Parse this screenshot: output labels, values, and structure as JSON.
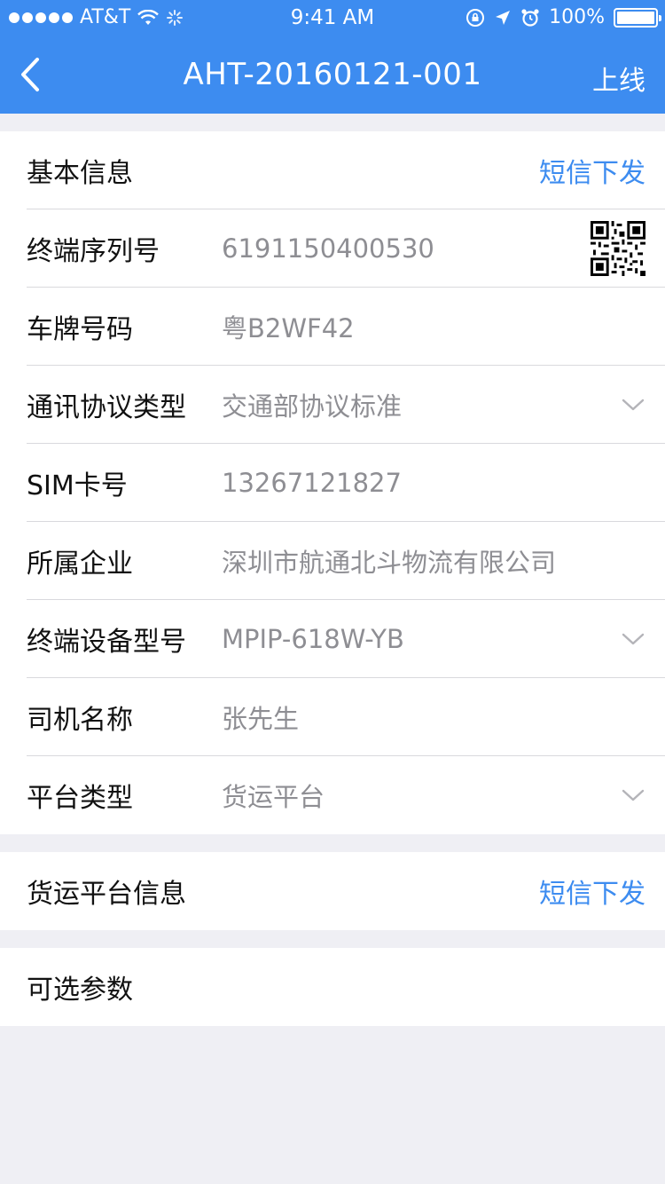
{
  "status_bar": {
    "carrier": "AT&T",
    "time": "9:41 AM",
    "battery": "100%"
  },
  "nav": {
    "title": "AHT-20160121-001",
    "action_label": "上线"
  },
  "basic_info": {
    "header": "基本信息",
    "sms_link": "短信下发",
    "rows": [
      {
        "label": "终端序列号",
        "value": "6191150400530"
      },
      {
        "label": "车牌号码",
        "value": "粤B2WF42"
      },
      {
        "label": "通讯协议类型",
        "value": "交通部协议标准"
      },
      {
        "label": "SIM卡号",
        "value": "13267121827"
      },
      {
        "label": "所属企业",
        "value": "深圳市航通北斗物流有限公司"
      },
      {
        "label": "终端设备型号",
        "value": "MPIP-618W-YB"
      },
      {
        "label": "司机名称",
        "value": "张先生"
      },
      {
        "label": "平台类型",
        "value": "货运平台"
      }
    ]
  },
  "freight_info": {
    "header": "货运平台信息",
    "sms_link": "短信下发"
  },
  "optional_params": {
    "header": "可选参数"
  },
  "colors": {
    "accent": "#3d8cf0",
    "background": "#efeff4",
    "value_text": "#8e8e93"
  }
}
